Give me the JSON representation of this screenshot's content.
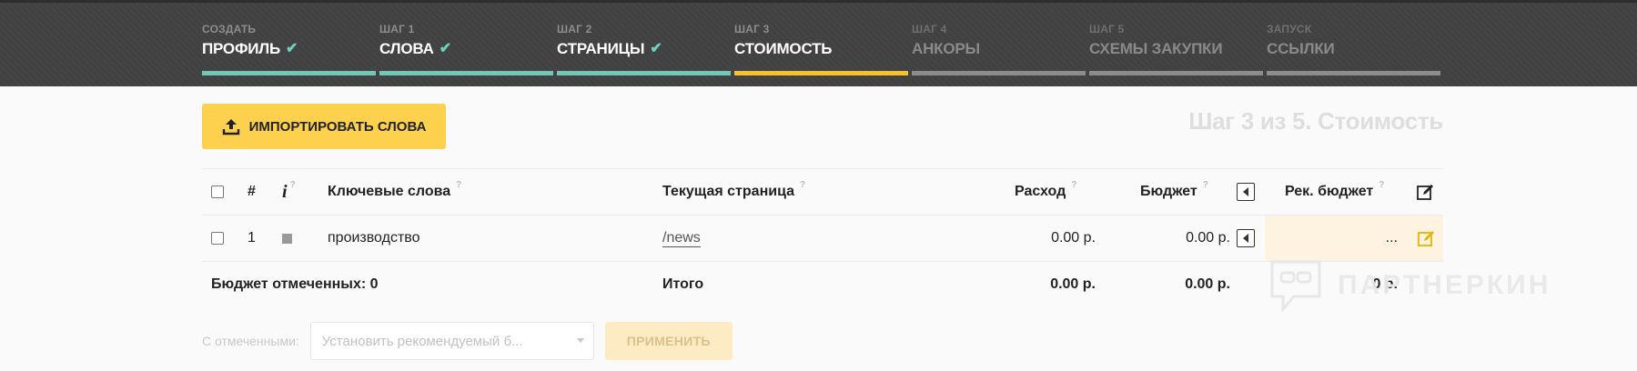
{
  "steps": [
    {
      "small": "СОЗДАТЬ",
      "big": "ПРОФИЛЬ",
      "state": "done"
    },
    {
      "small": "ШАГ 1",
      "big": "СЛОВА",
      "state": "done"
    },
    {
      "small": "ШАГ 2",
      "big": "СТРАНИЦЫ",
      "state": "done"
    },
    {
      "small": "ШАГ 3",
      "big": "СТОИМОСТЬ",
      "state": "active"
    },
    {
      "small": "ШАГ 4",
      "big": "АНКОРЫ",
      "state": "disabled"
    },
    {
      "small": "ШАГ 5",
      "big": "СХЕМЫ ЗАКУПКИ",
      "state": "disabled"
    },
    {
      "small": "ЗАПУСК",
      "big": "ССЫЛКИ",
      "state": "disabled"
    }
  ],
  "import_button": {
    "label": "ИМПОРТИРОВАТЬ СЛОВА"
  },
  "step_title": "Шаг 3 из 5. Стоимость",
  "table": {
    "headers": {
      "num": "#",
      "info": "i",
      "q_mark": "?",
      "keywords": "Ключевые слова",
      "current_page": "Текущая страница",
      "expense": "Расход",
      "budget": "Бюджет",
      "rec_budget": "Рек. бюджет"
    },
    "rows": [
      {
        "num": "1",
        "keyword": "производство",
        "page": "/news",
        "expense": "0.00 р.",
        "budget": "0.00 р.",
        "rec_budget": "..."
      }
    ],
    "footer": {
      "selected_budget": "Бюджет отмеченных: 0",
      "total_label": "Итого",
      "total_expense": "0.00 р.",
      "total_budget": "0.00 р.",
      "total_rec": "0 р."
    }
  },
  "bulk": {
    "label": "С отмеченными:",
    "select_value": "Установить рекомендуемый б...",
    "apply_label": "ПРИМЕНИТЬ"
  },
  "watermark": {
    "text": "ПАРТНЕРКИН"
  },
  "colors": {
    "accent_yellow": "#fdd14e",
    "done_teal": "#74c7b6",
    "active_bar": "#f2c230",
    "header_bg": "#414141"
  }
}
